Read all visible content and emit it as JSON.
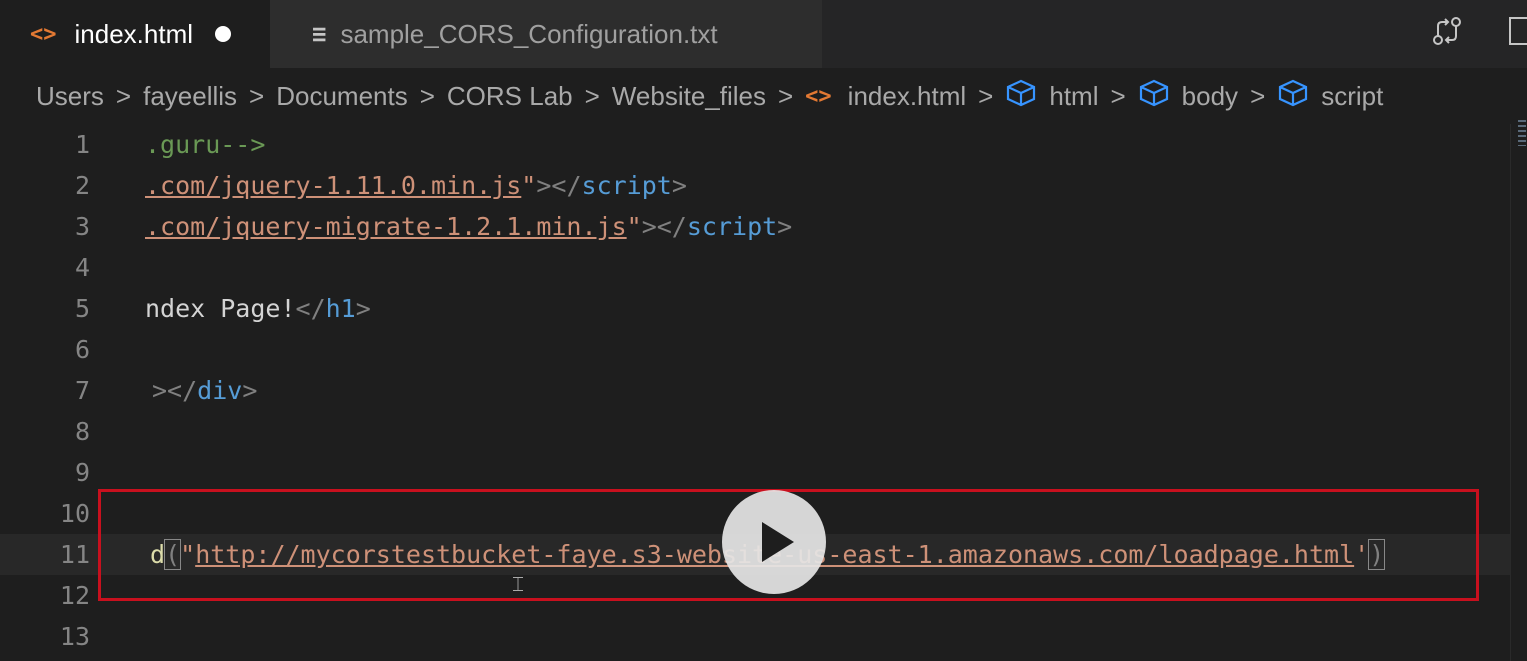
{
  "tabs": [
    {
      "label": "index.html",
      "icon": "html-file-icon",
      "glyph": "<>",
      "active": true,
      "dirty": true
    },
    {
      "label": "sample_CORS_Configuration.txt",
      "icon": "text-file-icon",
      "glyph": "≡",
      "active": false
    }
  ],
  "breadcrumb": {
    "items": [
      "Users",
      "fayeellis",
      "Documents",
      "CORS Lab",
      "Website_files"
    ],
    "file": "index.html",
    "symbols": [
      "html",
      "body",
      "script"
    ],
    "separator": ">"
  },
  "editor": {
    "lines": [
      {
        "n": "1"
      },
      {
        "n": "2"
      },
      {
        "n": "3"
      },
      {
        "n": "4"
      },
      {
        "n": "5"
      },
      {
        "n": "6"
      },
      {
        "n": "7"
      },
      {
        "n": "8"
      },
      {
        "n": "9"
      },
      {
        "n": "10"
      },
      {
        "n": "11"
      },
      {
        "n": "12"
      },
      {
        "n": "13"
      }
    ],
    "l1_comment": ".guru-->",
    "l2_url": ".com/jquery-1.11.0.min.js",
    "l2_tag": "script",
    "l3_url": ".com/jquery-migrate-1.2.1.min.js",
    "l3_tag": "script",
    "l5_text": "ndex Page!",
    "l5_tag": "h1",
    "l7_tag": "div",
    "l11_fn": "d",
    "l11_url": "http://mycorstestbucket-faye.s3-website-us-east-1.amazonaws.com/loadpage.html"
  },
  "colors": {
    "highlight_border": "#c8101e",
    "tab_active_bg": "#1e1e1e",
    "editor_bg": "#1e1e1e"
  }
}
